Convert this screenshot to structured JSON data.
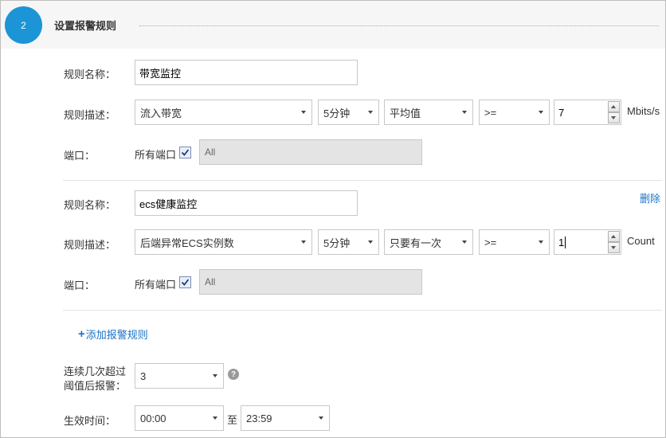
{
  "step": {
    "number": "2",
    "title": "设置报警规则"
  },
  "rules": [
    {
      "name_label": "规则名称：",
      "name_value": "带宽监控",
      "desc_label": "规则描述：",
      "metric": "流入带宽",
      "period": "5分钟",
      "statistic": "平均值",
      "operator": ">=",
      "threshold": "7",
      "unit": "Mbits/s",
      "port_label": "端口：",
      "all_ports_label": "所有端口",
      "ports_value": "All"
    },
    {
      "name_label": "规则名称：",
      "name_value": "ecs健康监控",
      "delete_label": "删除",
      "desc_label": "规则描述：",
      "metric": "后端异常ECS实例数",
      "period": "5分钟",
      "statistic": "只要有一次",
      "operator": ">=",
      "threshold": "1",
      "unit": "Count",
      "port_label": "端口：",
      "all_ports_label": "所有端口",
      "ports_value": "All"
    }
  ],
  "add_rule": {
    "plus": "+",
    "label": "添加报警规则"
  },
  "trigger": {
    "label_line1": "连续几次超过",
    "label_line2": "阈值后报警：",
    "value": "3",
    "help_icon": "?"
  },
  "effective_time": {
    "label": "生效时间：",
    "start": "00:00",
    "to": "至",
    "end": "23:59"
  },
  "colors": {
    "accent": "#1b95d6",
    "link": "#1b73c7",
    "disabled_bg": "#e4e4e4"
  }
}
